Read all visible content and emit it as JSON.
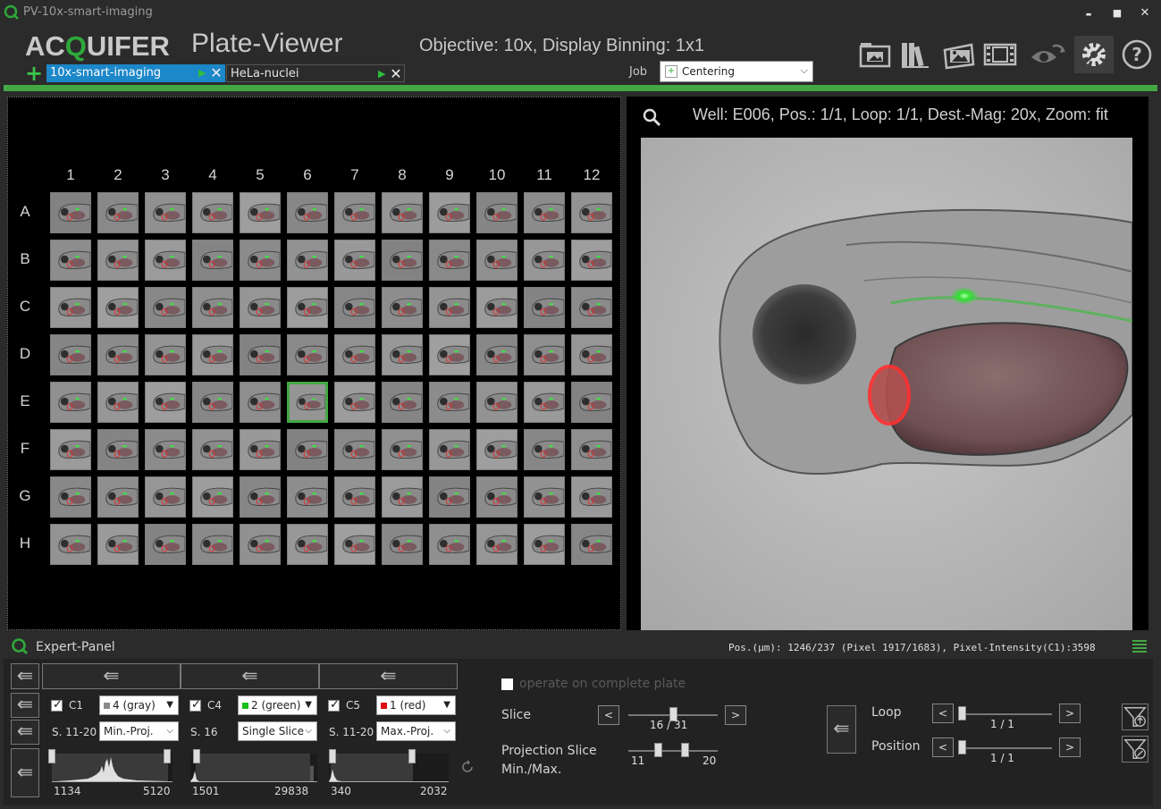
{
  "window": {
    "title": "PV-10x-smart-imaging",
    "minimize": "▬",
    "maximize": "■",
    "close": "✕"
  },
  "header": {
    "brand_pre": "AC",
    "brand_q": "Q",
    "brand_post": "UIFER",
    "app_name": "Plate-Viewer",
    "objective": "Objective: 10x, Display Binning: 1x1",
    "job_label": "Job",
    "job_value": "Centering"
  },
  "toolbar": {
    "icons": [
      "folder-image-icon",
      "library-icon",
      "image-export-icon",
      "film-icon",
      "eye-sync-icon",
      "settings-icon",
      "help-icon"
    ]
  },
  "tabs": [
    {
      "label": "10x-smart-imaging",
      "active": true
    },
    {
      "label": "HeLa-nuclei",
      "active": false
    }
  ],
  "tab_add": "+",
  "plate": {
    "columns": [
      "1",
      "2",
      "3",
      "4",
      "5",
      "6",
      "7",
      "8",
      "9",
      "10",
      "11",
      "12"
    ],
    "rows": [
      "A",
      "B",
      "C",
      "D",
      "E",
      "F",
      "G",
      "H"
    ],
    "selected_well": "E6"
  },
  "viewer": {
    "info": "Well: E006, Pos.: 1/1, Loop: 1/1, Dest.-Mag: 20x, Zoom: fit"
  },
  "expert_panel": {
    "title": "Expert-Panel",
    "position_readout": "Pos.(µm): 1246/237 (Pixel 1917/1683), Pixel-Intensity(C1):3598",
    "channels": [
      {
        "name": "C1",
        "checked": true,
        "color_label": "4 (gray)",
        "swatch": "#8a8a8a",
        "slice_label": "S. 11-20",
        "mode": "Min.-Proj.",
        "min": "1134",
        "max": "5120"
      },
      {
        "name": "C4",
        "checked": true,
        "color_label": "2 (green)",
        "swatch": "#18c018",
        "slice_label": "S. 16",
        "mode": "Single Slice",
        "min": "1501",
        "max": "29838"
      },
      {
        "name": "C5",
        "checked": true,
        "color_label": "1 (red)",
        "swatch": "#e01010",
        "slice_label": "S. 11-20",
        "mode": "Max.-Proj.",
        "min": "340",
        "max": "2032"
      }
    ],
    "operate_label": "operate on complete plate",
    "slice_label": "Slice",
    "slice_value": "16 / 31",
    "projection_label_1": "Projection Slice",
    "projection_label_2": "Min./Max.",
    "projection_min": "11",
    "projection_max": "20",
    "loop_label": "Loop",
    "loop_value": "1 / 1",
    "position_label": "Position",
    "position_value": "1 / 1",
    "btn_prev": "<",
    "btn_next": ">",
    "collapse_glyph": "⇚"
  },
  "colors": {
    "accent_green": "#43a843",
    "tab_blue": "#1c87c9",
    "background": "#2b2b2b"
  }
}
